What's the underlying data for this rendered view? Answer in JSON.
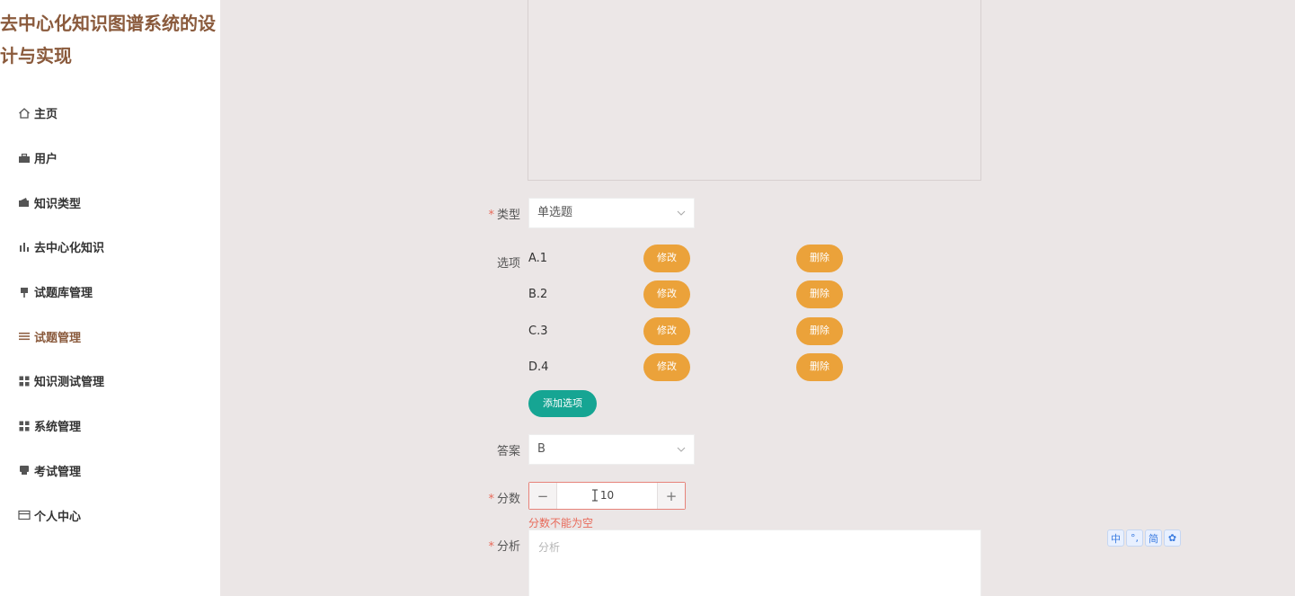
{
  "sidebar": {
    "title": "去中心化知识图谱系统的设计与实现",
    "items": [
      {
        "label": "主页",
        "icon": "home-icon"
      },
      {
        "label": "用户",
        "icon": "briefcase-icon"
      },
      {
        "label": "知识类型",
        "icon": "wallet-icon"
      },
      {
        "label": "去中心化知识",
        "icon": "bar-chart-icon"
      },
      {
        "label": "试题库管理",
        "icon": "pin-icon"
      },
      {
        "label": "试题管理",
        "icon": "list-icon"
      },
      {
        "label": "知识测试管理",
        "icon": "grid-icon"
      },
      {
        "label": "系统管理",
        "icon": "grid-icon"
      },
      {
        "label": "考试管理",
        "icon": "printer-icon"
      },
      {
        "label": "个人中心",
        "icon": "card-icon"
      }
    ]
  },
  "form": {
    "type_label": "类型",
    "type_value": "单选题",
    "options_label": "选项",
    "options": [
      {
        "text": "A.1",
        "edit": "修改",
        "delete": "删除"
      },
      {
        "text": "B.2",
        "edit": "修改",
        "delete": "删除"
      },
      {
        "text": "C.3",
        "edit": "修改",
        "delete": "删除"
      },
      {
        "text": "D.4",
        "edit": "修改",
        "delete": "删除"
      }
    ],
    "add_option": "添加选项",
    "answer_label": "答案",
    "answer_value": "B",
    "score_label": "分数",
    "score_value": "10",
    "score_error": "分数不能为空",
    "analysis_label": "分析",
    "analysis_placeholder": "分析"
  },
  "ime": {
    "keys": [
      "中",
      "°,",
      "简",
      "✿"
    ]
  },
  "colors": {
    "brand": "#8a5a3c",
    "orange": "#eba23a",
    "green": "#16a593",
    "error": "#e86a5a"
  }
}
